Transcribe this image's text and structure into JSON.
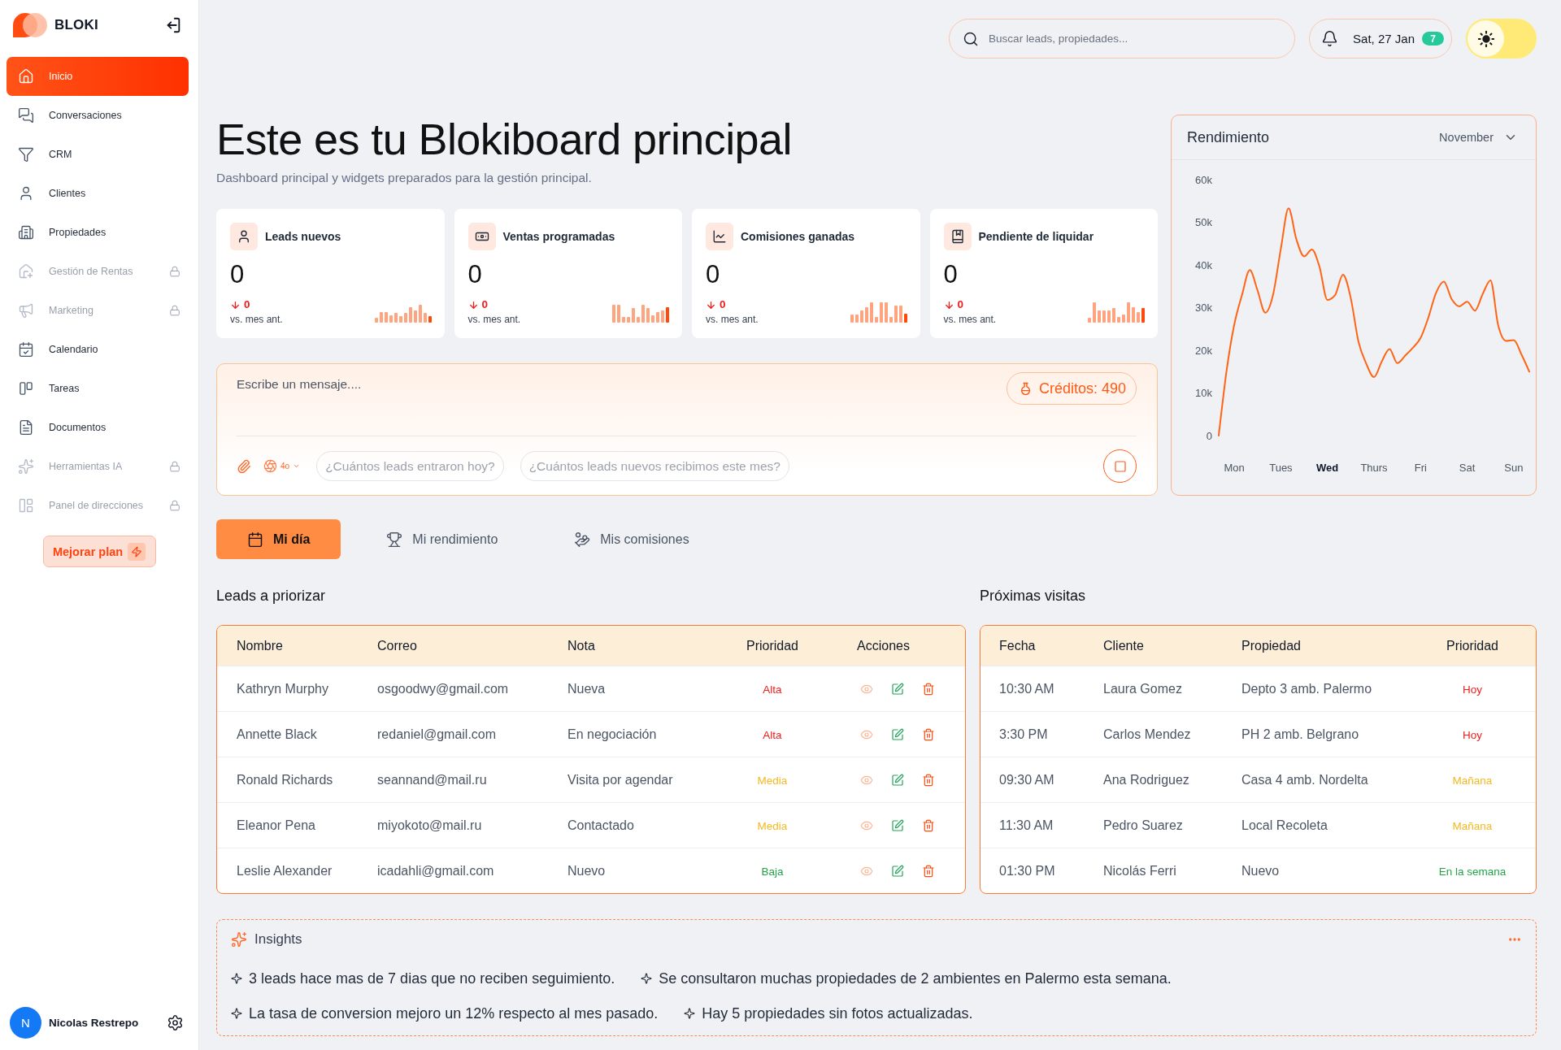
{
  "sidebar": {
    "brand": "BLOKI",
    "nav": [
      {
        "label": "Inicio",
        "selected": true,
        "locked": false
      },
      {
        "label": "Conversaciones",
        "selected": false,
        "locked": false
      },
      {
        "label": "CRM",
        "selected": false,
        "locked": false
      },
      {
        "label": "Clientes",
        "selected": false,
        "locked": false
      },
      {
        "label": "Propiedades",
        "selected": false,
        "locked": false
      },
      {
        "label": "Gestión de Rentas",
        "selected": false,
        "locked": true
      },
      {
        "label": "Marketing",
        "selected": false,
        "locked": true
      },
      {
        "label": "Calendario",
        "selected": false,
        "locked": false
      },
      {
        "label": "Tareas",
        "selected": false,
        "locked": false
      },
      {
        "label": "Documentos",
        "selected": false,
        "locked": false
      },
      {
        "label": "Herramientas IA",
        "selected": false,
        "locked": true
      },
      {
        "label": "Panel de direcciones",
        "selected": false,
        "locked": true
      }
    ],
    "upgrade_button": "Mejorar plan",
    "user": {
      "initial": "N",
      "name": "Nicolas Restrepo"
    }
  },
  "header": {
    "search": {
      "placeholder": "Buscar leads, propiedades..."
    },
    "date": "Sat, 27 Jan",
    "notification_count": "7",
    "dark_mode": false
  },
  "title": "Este es tu Blokiboard principal",
  "subtitle": "Dashboard principal y widgets preparados para la gestión principal.",
  "stats": [
    {
      "title": "Leads nuevos",
      "value": "0",
      "decreased": true,
      "delta": "0",
      "comparison": "vs. mes ant."
    },
    {
      "title": "Ventas programadas",
      "value": "0",
      "decreased": true,
      "delta": "0",
      "comparison": "vs. mes ant."
    },
    {
      "title": "Comisiones ganadas",
      "value": "0",
      "decreased": true,
      "delta": "0",
      "comparison": "vs. mes ant."
    },
    {
      "title": "Pendiente de liquidar",
      "value": "0",
      "decreased": true,
      "delta": "0",
      "comparison": "vs. mes ant."
    }
  ],
  "performance": {
    "title": "Rendimiento",
    "period": "November",
    "days": [
      {
        "selected": false
      },
      {
        "selected": false
      },
      {
        "selected": true
      },
      {
        "selected": false
      },
      {
        "selected": false
      },
      {
        "selected": false
      },
      {
        "selected": false
      }
    ],
    "chart_data": {
      "type": "line",
      "categories": [
        null,
        null,
        "Mon",
        null,
        null,
        null,
        null,
        null,
        "Tues",
        null,
        null,
        null,
        null,
        null,
        "Wed",
        null,
        null,
        null,
        null,
        null,
        "Thurs",
        null,
        null,
        null,
        null,
        null,
        "Fri",
        null,
        null,
        null,
        null,
        null,
        "Sat",
        null,
        null,
        null,
        null,
        null,
        "Sun",
        null,
        null
      ],
      "series": [
        {
          "color": "#ff6414",
          "values": [
            0,
            15000,
            26000,
            33000,
            38800,
            34000,
            28800,
            33000,
            43800,
            53300,
            46000,
            42000,
            43600,
            39400,
            31800,
            33000,
            37700,
            32300,
            22000,
            16900,
            13700,
            17400,
            20300,
            17000,
            18700,
            20600,
            22900,
            27700,
            33500,
            36100,
            32000,
            30300,
            31400,
            29300,
            33200,
            36400,
            25800,
            22200,
            22400,
            19000,
            15000
          ]
        }
      ],
      "ylim": [
        0,
        60000
      ],
      "yticks": [
        {
          "value": 0,
          "label": "0"
        },
        {
          "value": 10000,
          "label": "10k"
        },
        {
          "value": 20000,
          "label": "20k"
        },
        {
          "value": 30000,
          "label": "30k"
        },
        {
          "value": 40000,
          "label": "40k"
        },
        {
          "value": 50000,
          "label": "50k"
        },
        {
          "value": 60000,
          "label": "60k"
        }
      ]
    }
  },
  "chat": {
    "placeholder": "Escribe un mensaje....",
    "credits": "Créditos: 490",
    "model": "4o",
    "suggestions": [
      "¿Cuántos leads entraron hoy?",
      "¿Cuántos leads nuevos recibimos este mes?"
    ]
  },
  "tabs": [
    {
      "label": "Mi día",
      "selected": true
    },
    {
      "label": "Mi rendimiento",
      "selected": false
    },
    {
      "label": "Mis comisiones",
      "selected": false
    }
  ],
  "leads": {
    "title": "Leads a priorizar",
    "columns": [
      "Nombre",
      "Correo",
      "Nota",
      "Prioridad",
      "Acciones"
    ],
    "rows": [
      {
        "name": "Kathryn Murphy",
        "email": "osgoodwy@gmail.com",
        "note": "Nueva",
        "priority": {
          "label": "Alta",
          "color": "#f01c1c"
        }
      },
      {
        "name": "Annette Black",
        "email": "redaniel@gmail.com",
        "note": "En negociación",
        "priority": {
          "label": "Alta",
          "color": "#f01c1c"
        }
      },
      {
        "name": "Ronald Richards",
        "email": "seannand@mail.ru",
        "note": "Visita por agendar",
        "priority": {
          "label": "Media",
          "color": "#f4b820"
        }
      },
      {
        "name": "Eleanor Pena",
        "email": "miyokoto@mail.ru",
        "note": "Contactado",
        "priority": {
          "label": "Media",
          "color": "#f4b820"
        }
      },
      {
        "name": "Leslie Alexander",
        "email": "icadahli@gmail.com",
        "note": "Nuevo",
        "priority": {
          "label": "Baja",
          "color": "#22a34a"
        }
      }
    ]
  },
  "visits": {
    "title": "Próximas visitas",
    "columns": [
      "Fecha",
      "Cliente",
      "Propiedad",
      "Prioridad"
    ],
    "rows": [
      {
        "time": "10:30 AM",
        "client": "Laura Gomez",
        "property": "Depto 3 amb. Palermo",
        "priority": {
          "label": "Hoy",
          "color": "#f01c1c"
        }
      },
      {
        "time": "3:30 PM",
        "client": "Carlos Mendez",
        "property": "PH 2 amb. Belgrano",
        "priority": {
          "label": "Hoy",
          "color": "#f01c1c"
        }
      },
      {
        "time": "09:30 AM",
        "client": "Ana Rodriguez",
        "property": "Casa 4 amb. Nordelta",
        "priority": {
          "label": "Mañana",
          "color": "#f4b820"
        }
      },
      {
        "time": "11:30 AM",
        "client": "Pedro Suarez",
        "property": "Local Recoleta",
        "priority": {
          "label": "Mañana",
          "color": "#f4b820"
        }
      },
      {
        "time": "01:30 PM",
        "client": "Nicolás Ferri",
        "property": "Nuevo",
        "priority": {
          "label": "En la semana",
          "color": "#22a34a"
        }
      }
    ]
  },
  "insights": {
    "title": "Insights",
    "items": [
      "3 leads hace mas de 7 dias que no reciben seguimiento.",
      "Se consultaron muchas propiedades de 2 ambientes en Palermo esta semana.",
      "La tasa de conversion mejoro un 12% respecto al mes pasado.",
      "Hay 5 propiedades sin fotos actualizadas."
    ]
  }
}
